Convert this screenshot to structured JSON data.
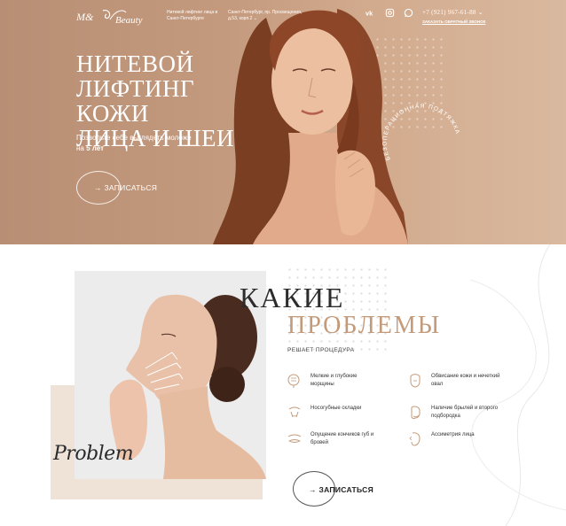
{
  "header": {
    "tagline": "Нитевой лифтинг лица в Санкт-Петербурге",
    "address": "Санкт-Петербург, пр. Просвещения, д.53, корп.2",
    "phone": "+7 (921) 967-61-88",
    "callback_label": "ЗАКАЗАТЬ ОБРАТНЫЙ ЗВОНОК",
    "social_icons": [
      "vk-icon",
      "instagram-icon",
      "whatsapp-icon"
    ]
  },
  "hero": {
    "title_line1": "НИТЕВОЙ",
    "title_line2": "ЛИФТИНГ КОЖИ",
    "title_line3": "ЛИЦА И ШЕИ",
    "subtitle_pre": "Позвольте себе выглядеть моложе на ",
    "subtitle_bold": "5 лет",
    "button_label": "→ ЗАПИСАТЬСЯ",
    "circle_text": "БЕЗОПЕРАЦИОННАЯ ПОДТЯЖКА ЛИЦА"
  },
  "problems": {
    "heading_line1": "КАКИЕ",
    "heading_line2": "ПРОБЛЕМЫ",
    "subheading": "РЕШАЕТ ПРОЦЕДУРА",
    "script_label": "Problem",
    "items": [
      {
        "text": "Мелкие и глубокие морщины",
        "icon": "face-wrinkles-icon"
      },
      {
        "text": "Обвисание кожи и нечеткий овал",
        "icon": "face-oval-icon"
      },
      {
        "text": "Носогубные складки",
        "icon": "nasolabial-icon"
      },
      {
        "text": "Наличие брылей и второго подбородка",
        "icon": "double-chin-icon"
      },
      {
        "text": "Опущение кончиков губ и бровей",
        "icon": "eyebrow-icon"
      },
      {
        "text": "Ассиметрия лица",
        "icon": "face-asymmetry-icon"
      }
    ],
    "button_label": "→ ЗАПИСАТЬСЯ"
  }
}
